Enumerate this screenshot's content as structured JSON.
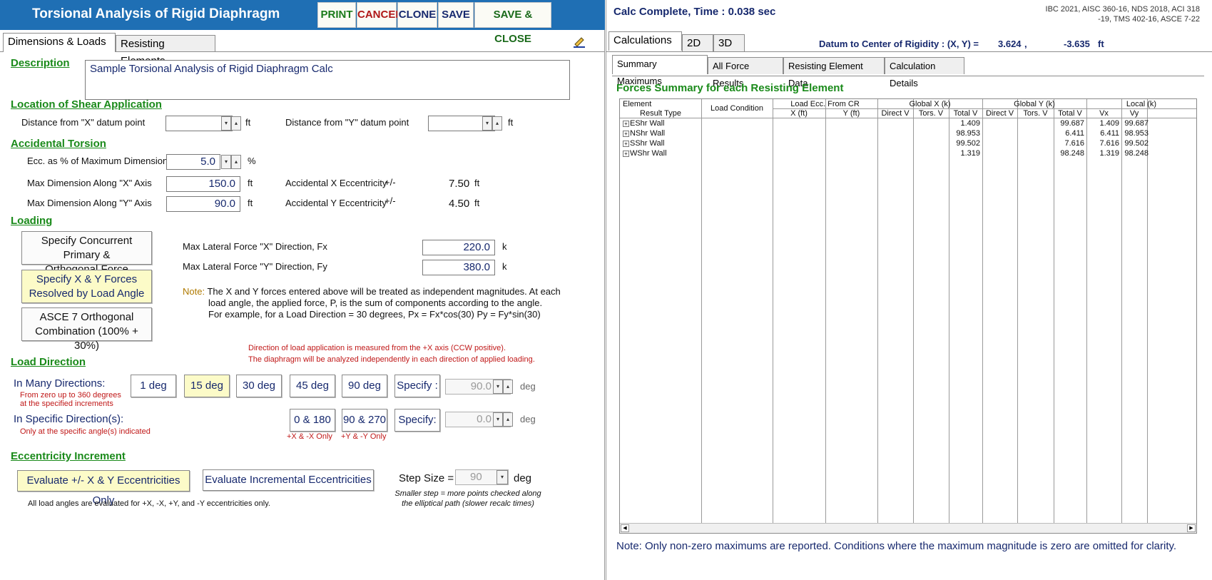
{
  "app": {
    "title": "Torsional Analysis of Rigid Diaphragm",
    "help": "?"
  },
  "toolbar": {
    "print": "PRINT",
    "cancel": "CANCEL",
    "clone": "CLONE",
    "save": "SAVE",
    "save_close": "SAVE & CLOSE"
  },
  "left_tabs": [
    "Dimensions & Loads",
    "Resisting Elements"
  ],
  "description": {
    "label": "Description",
    "value": "Sample Torsional Analysis of Rigid Diaphragm Calc"
  },
  "shear_location": {
    "heading": "Location of Shear Application",
    "x_label": "Distance from \"X\" datum point",
    "x_value": "",
    "x_unit": "ft",
    "y_label": "Distance from \"Y\" datum point",
    "y_value": "",
    "y_unit": "ft"
  },
  "accidental_torsion": {
    "heading": "Accidental Torsion",
    "ecc_label": "Ecc. as % of Maximum Dimension",
    "ecc_value": "5.0",
    "ecc_unit": "%",
    "max_x_label": "Max Dimension Along \"X\" Axis",
    "max_x_value": "150.0",
    "max_x_unit": "ft",
    "max_y_label": "Max Dimension Along \"Y\" Axis",
    "max_y_value": "90.0",
    "max_y_unit": "ft",
    "acc_x_label": "Accidental X Eccentricity",
    "acc_x_pm": "+/-",
    "acc_x_value": "7.50",
    "acc_x_unit": "ft",
    "acc_y_label": "Accidental Y Eccentricity",
    "acc_y_pm": "+/-",
    "acc_y_value": "4.50",
    "acc_y_unit": "ft"
  },
  "loading": {
    "heading": "Loading",
    "btn_concurrent_line1": "Specify Concurrent Primary &",
    "btn_concurrent_line2": "Orthogonal Force",
    "btn_xy_line1": "Specify X & Y Forces",
    "btn_xy_line2": "Resolved by Load Angle",
    "btn_asce_line1": "ASCE 7 Orthogonal",
    "btn_asce_line2": "Combination (100% + 30%)",
    "fx_label": "Max Lateral Force \"X\" Direction, Fx",
    "fx_value": "220.0",
    "fx_unit": "k",
    "fy_label": "Max Lateral Force \"Y\" Direction, Fy",
    "fy_value": "380.0",
    "fy_unit": "k",
    "note_label": "Note:",
    "note_line1": "The X and Y forces entered above will be treated as independent magnitudes.  At each",
    "note_line2": "load angle, the applied force, P, is the sum of components according to the angle.",
    "note_line3": "For example, for a Load Direction = 30 degrees, Px = Fx*cos(30)  Py = Fy*sin(30)",
    "red_note_line1": "Direction of load application is measured from the +X axis (CCW positive).",
    "red_note_line2": "The diaphragm will be analyzed independently in each direction of applied loading."
  },
  "load_direction": {
    "heading": "Load Direction",
    "many_label": "In Many Directions:",
    "many_sub1": "From zero up to 360 degrees",
    "many_sub2": "at the specified increments",
    "deg_buttons": [
      "1 deg",
      "15 deg",
      "30 deg",
      "45 deg",
      "90 deg"
    ],
    "specify_label": "Specify :",
    "specify_value": "90.0",
    "specify_unit": "deg",
    "specific_label": "In Specific Direction(s):",
    "specific_sub": "Only at the specific angle(s) indicated",
    "specific_buttons": [
      "0 & 180",
      "90 & 270"
    ],
    "specific_sub_labels": [
      "+X & -X Only",
      "+Y & -Y Only"
    ],
    "specify2_label": "Specify:",
    "specify2_value": "0.0",
    "specify2_unit": "deg"
  },
  "eccentricity_increment": {
    "heading": "Eccentricity Increment",
    "btn_only": "Evaluate +/- X & Y Eccentricities Only",
    "btn_incremental": "Evaluate Incremental Eccentricities",
    "step_label": "Step Size =",
    "step_value": "90",
    "step_unit": "deg",
    "step_note1": "Smaller step = more points checked along",
    "step_note2": "the elliptical path (slower recalc times)",
    "footer": "All load angles are evaluated for +X, -X, +Y, and -Y eccentricities only."
  },
  "right": {
    "status_label": "Calc Complete, Time :",
    "status_value": "0.038 sec",
    "codes_line1": "IBC 2021, AISC 360-16, NDS 2018, ACI 318",
    "codes_line2": "-19, TMS 402-16, ASCE 7-22",
    "tabs": [
      "Calculations",
      "2D",
      "3D"
    ],
    "datum_label": "Datum to Center of Rigidity :  (X, Y) =",
    "datum_x": "3.624",
    "datum_comma": ",",
    "datum_y": "-3.635",
    "datum_unit": "ft",
    "sub_tabs": [
      "Summary Maximums",
      "All Force Results",
      "Resisting Element Data",
      "Calculation Details"
    ],
    "table_title": "Forces Summary for each Resisting Element",
    "table": {
      "col_element": "Element",
      "col_result_type": "Result Type",
      "col_load_condition": "Load Condition",
      "group_load_ecc": "Load Ecc. From CR",
      "group_global_x": "Global X (k)",
      "group_global_y": "Global Y (k)",
      "group_local": "Local (k)",
      "sub_headers": [
        "X  (ft)",
        "Y  (ft)",
        "Direct V",
        "Tors. V",
        "Total V",
        "Direct V",
        "Tors. V",
        "Total V",
        "Vx",
        "Vy"
      ],
      "rows": [
        {
          "name": "EShr Wall",
          "gx_total": "1.409",
          "gy_total": "99.687",
          "vx": "1.409",
          "vy": "99.687"
        },
        {
          "name": "NShr Wall",
          "gx_total": "98.953",
          "gy_total": "6.411",
          "vx": "6.411",
          "vy": "98.953"
        },
        {
          "name": "SShr Wall",
          "gx_total": "99.502",
          "gy_total": "7.616",
          "vx": "7.616",
          "vy": "99.502"
        },
        {
          "name": "WShr Wall",
          "gx_total": "1.319",
          "gy_total": "98.248",
          "vx": "1.319",
          "vy": "98.248"
        }
      ]
    },
    "bottom_note": "Note: Only non-zero maximums are reported.  Conditions where the maximum magnitude is zero are omitted for clarity."
  },
  "colors": {
    "title_bar": "#1f6fb4",
    "section_heading": "#1a8a1a",
    "value_text": "#17296e",
    "selected_button": "#fcfbc8",
    "red_note": "#c01818"
  }
}
